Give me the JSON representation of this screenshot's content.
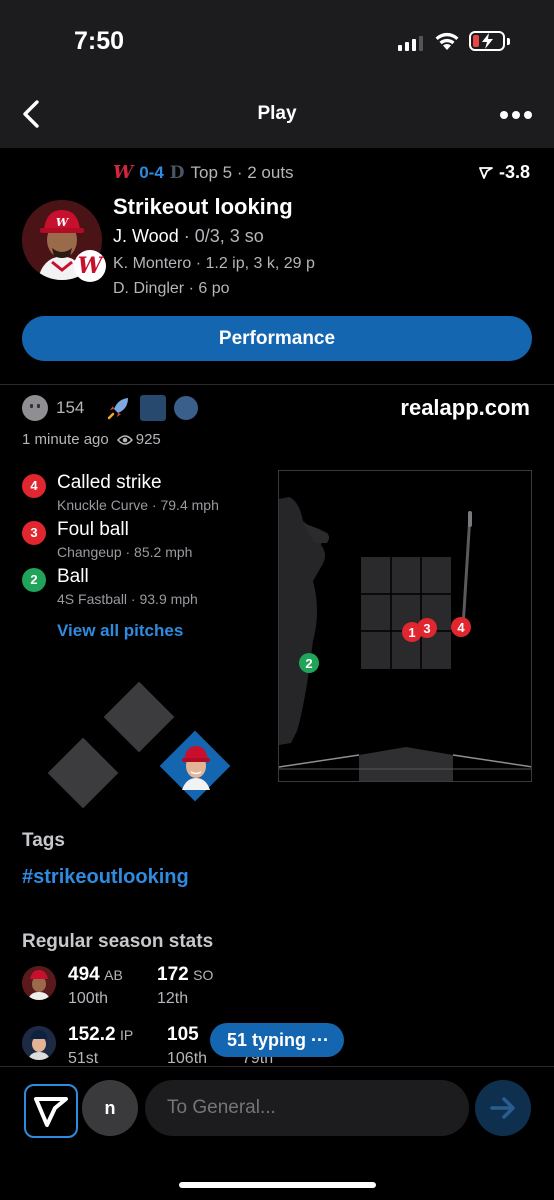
{
  "status_bar": {
    "time": "7:50"
  },
  "nav": {
    "title": "Play"
  },
  "play": {
    "score": "0-4",
    "inning": "Top 5 · 2 outs",
    "wpa": "-3.8",
    "title": "Strikeout looking",
    "batter_name": "J. Wood",
    "batter_line": " · 0/3, 3 so",
    "pitcher_line": "K. Montero · 1.2 ip, 3 k, 29 p",
    "catcher_line": "D. Dingler · 6 po",
    "performance_label": "Performance"
  },
  "social": {
    "reaction_count": "154",
    "site": "realapp.com",
    "time_ago": "1 minute ago",
    "views": "925"
  },
  "pitches": [
    {
      "num": "4",
      "result": "Called strike",
      "desc": "Knuckle Curve · 79.4 mph",
      "color": "#e0262f"
    },
    {
      "num": "3",
      "result": "Foul ball",
      "desc": "Changeup · 85.2 mph",
      "color": "#e0262f"
    },
    {
      "num": "2",
      "result": "Ball",
      "desc": "4S Fastball · 93.9 mph",
      "color": "#1fa45a"
    }
  ],
  "view_all_label": "View all pitches",
  "zone_markers": [
    {
      "num": "1",
      "color": "#e0262f"
    },
    {
      "num": "3",
      "color": "#e0262f"
    },
    {
      "num": "4",
      "color": "#e0262f"
    },
    {
      "num": "2",
      "color": "#1fa45a"
    }
  ],
  "tags": {
    "heading": "Tags",
    "items": [
      "#strikeoutlooking"
    ]
  },
  "season_stats": {
    "heading": "Regular season stats",
    "rows": [
      {
        "cells": [
          {
            "value": "494",
            "unit": "AB",
            "rank": "100th"
          },
          {
            "value": "172",
            "unit": "SO",
            "rank": "12th"
          }
        ]
      },
      {
        "cells": [
          {
            "value": "152.2",
            "unit": "IP",
            "rank": "51st"
          },
          {
            "value": "105",
            "unit": "",
            "rank": "106th"
          },
          {
            "value": "",
            "unit": "",
            "rank": "79th"
          }
        ]
      }
    ]
  },
  "typing_indicator": "51 typing ···",
  "composer": {
    "channel_initial": "n",
    "placeholder": "To General..."
  },
  "colors": {
    "accent": "#1466b0",
    "link": "#2f8be0",
    "strike": "#e0262f",
    "ball": "#1fa45a"
  }
}
